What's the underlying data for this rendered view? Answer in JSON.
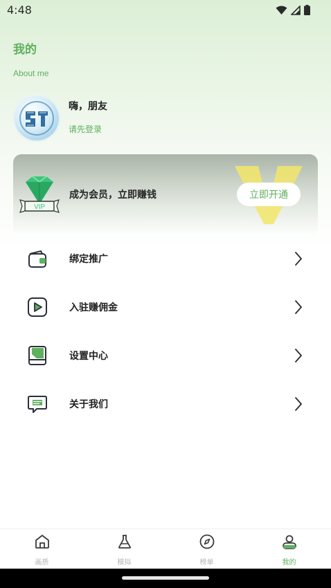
{
  "status_bar": {
    "time": "4:48",
    "icons": [
      "wifi-icon",
      "signal-icon",
      "battery-icon"
    ]
  },
  "page": {
    "title": "我的",
    "subtitle": "About me"
  },
  "profile": {
    "greeting": "嗨，朋友",
    "login_prompt": "请先登录",
    "avatar_icon": "user-avatar"
  },
  "vip": {
    "badge": "VIP",
    "text": "成为会员，立即赚钱",
    "button_label": "立即开通"
  },
  "menu": [
    {
      "label": "绑定推广",
      "icon": "wallet-icon"
    },
    {
      "label": "入驻赚佣金",
      "icon": "play-icon"
    },
    {
      "label": "设置中心",
      "icon": "book-icon"
    },
    {
      "label": "关于我们",
      "icon": "chat-icon"
    }
  ],
  "tabs": [
    {
      "label": "画质",
      "icon": "home-icon",
      "active": false
    },
    {
      "label": "模拟",
      "icon": "flask-icon",
      "active": false
    },
    {
      "label": "榜单",
      "icon": "compass-icon",
      "active": false
    },
    {
      "label": "我的",
      "icon": "profile-icon",
      "active": true
    }
  ],
  "colors": {
    "accent": "#5fb05f",
    "text": "#222222",
    "inactive": "#b6b6b6",
    "vip_gold": "#f2e66a"
  }
}
